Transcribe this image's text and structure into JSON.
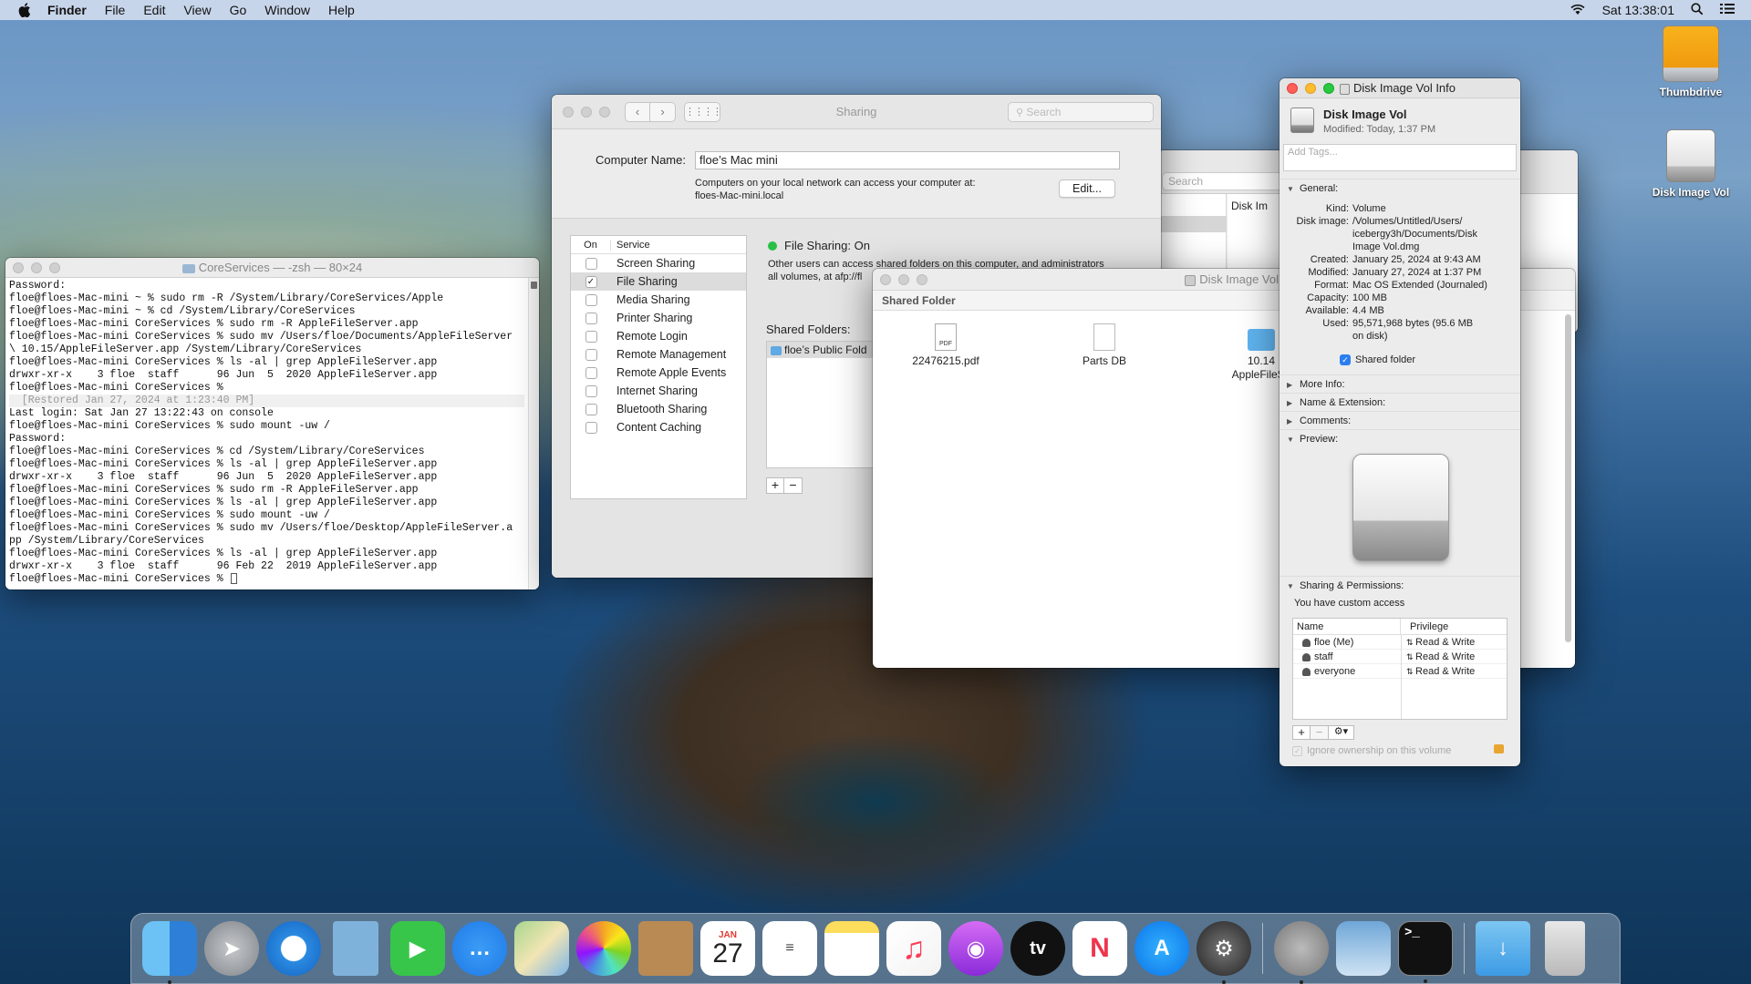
{
  "menubar": {
    "app": "Finder",
    "items": [
      "File",
      "Edit",
      "View",
      "Go",
      "Window",
      "Help"
    ],
    "clock": "Sat 13:38:01"
  },
  "desktop": {
    "icons": [
      "Thumbdrive",
      "Disk Image Vol"
    ]
  },
  "terminal": {
    "title": "CoreServices — -zsh — 80×24",
    "lines": [
      "Password:",
      "floe@floes-Mac-mini ~ % sudo rm -R /System/Library/CoreServices/Apple",
      "floe@floes-Mac-mini ~ % cd /System/Library/CoreServices",
      "floe@floes-Mac-mini CoreServices % sudo rm -R AppleFileServer.app",
      "floe@floes-Mac-mini CoreServices % sudo mv /Users/floe/Documents/AppleFileServer",
      "\\ 10.15/AppleFileServer.app /System/Library/CoreServices",
      "floe@floes-Mac-mini CoreServices % ls -al | grep AppleFileServer.app",
      "drwxr-xr-x    3 floe  staff      96 Jun  5  2020 AppleFileServer.app",
      "floe@floes-Mac-mini CoreServices %",
      "  [Restored Jan 27, 2024 at 1:23:40 PM]",
      "Last login: Sat Jan 27 13:22:43 on console",
      "floe@floes-Mac-mini CoreServices % sudo mount -uw /",
      "Password:",
      "floe@floes-Mac-mini CoreServices % cd /System/Library/CoreServices",
      "floe@floes-Mac-mini CoreServices % ls -al | grep AppleFileServer.app",
      "drwxr-xr-x    3 floe  staff      96 Jun  5  2020 AppleFileServer.app",
      "floe@floes-Mac-mini CoreServices % sudo rm -R AppleFileServer.app",
      "floe@floes-Mac-mini CoreServices % ls -al | grep AppleFileServer.app",
      "floe@floes-Mac-mini CoreServices % sudo mount -uw /",
      "floe@floes-Mac-mini CoreServices % sudo mv /Users/floe/Desktop/AppleFileServer.a",
      "pp /System/Library/CoreServices",
      "floe@floes-Mac-mini CoreServices % ls -al | grep AppleFileServer.app",
      "drwxr-xr-x    3 floe  staff      96 Feb 22  2019 AppleFileServer.app",
      "floe@floes-Mac-mini CoreServices % "
    ]
  },
  "sharing": {
    "title": "Sharing",
    "search_placeholder": "Search",
    "computer_name_label": "Computer Name:",
    "computer_name": "floe’s Mac mini",
    "address_note": "Computers on your local network can access your computer at:",
    "address": "floes-Mac-mini.local",
    "edit_button": "Edit...",
    "col_on": "On",
    "col_service": "Service",
    "services": [
      {
        "name": "Screen Sharing",
        "on": false
      },
      {
        "name": "File Sharing",
        "on": true
      },
      {
        "name": "Media Sharing",
        "on": false
      },
      {
        "name": "Printer Sharing",
        "on": false
      },
      {
        "name": "Remote Login",
        "on": false
      },
      {
        "name": "Remote Management",
        "on": false
      },
      {
        "name": "Remote Apple Events",
        "on": false
      },
      {
        "name": "Internet Sharing",
        "on": false
      },
      {
        "name": "Bluetooth Sharing",
        "on": false
      },
      {
        "name": "Content Caching",
        "on": false
      }
    ],
    "status": "File Sharing: On",
    "status_desc_1": "Other users can access shared folders on this computer, and administrators",
    "status_desc_2": "all volumes, at afp://fl",
    "shared_folders_label": "Shared Folders:",
    "shared_folder_item": "floe’s Public Fold"
  },
  "behind_finder": {
    "search_placeholder": "Search",
    "item": "Disk Im"
  },
  "finder": {
    "title": "Disk Image Vol",
    "header": "Shared Folder",
    "files": [
      {
        "name": "22476215.pdf",
        "icon": "pdf-file-icon",
        "label2": ""
      },
      {
        "name": "Parts DB",
        "icon": "generic-file-icon",
        "label2": ""
      },
      {
        "name": "10.14",
        "icon": "folder-icon",
        "label2": "AppleFileSe"
      }
    ]
  },
  "info": {
    "title": "Disk Image Vol Info",
    "name": "Disk Image Vol",
    "modified_line": "Modified: Today, 1:37 PM",
    "tags_placeholder": "Add Tags...",
    "general_label": "General:",
    "rows": [
      {
        "k": "Kind:",
        "v": "Volume"
      },
      {
        "k": "Disk image:",
        "v": "/Volumes/Untitled/Users/"
      },
      {
        "k": "",
        "v": "icebergy3h/Documents/Disk"
      },
      {
        "k": "",
        "v": "Image Vol.dmg"
      },
      {
        "k": "Created:",
        "v": "January 25, 2024 at 9:43 AM"
      },
      {
        "k": "Modified:",
        "v": "January 27, 2024 at 1:37 PM"
      },
      {
        "k": "Format:",
        "v": "Mac OS Extended (Journaled)"
      },
      {
        "k": "Capacity:",
        "v": "100 MB"
      },
      {
        "k": "Available:",
        "v": "4.4 MB"
      },
      {
        "k": "Used:",
        "v": "95,571,968 bytes (95.6 MB"
      },
      {
        "k": "",
        "v": "on disk)"
      }
    ],
    "shared_folder_label": "Shared folder",
    "more_info": "More Info:",
    "name_ext": "Name & Extension:",
    "comments": "Comments:",
    "preview": "Preview:",
    "sharing_perm": "Sharing & Permissions:",
    "custom_access": "You have custom access",
    "col_name": "Name",
    "col_priv": "Privilege",
    "perms": [
      {
        "name": "floe (Me)",
        "priv": "Read & Write"
      },
      {
        "name": "staff",
        "priv": "Read & Write"
      },
      {
        "name": "everyone",
        "priv": "Read & Write"
      }
    ],
    "ignore_ownership": "Ignore ownership on this volume"
  },
  "dock": {
    "calendar_month": "JAN",
    "calendar_day": "27",
    "tv_label": "tv"
  }
}
